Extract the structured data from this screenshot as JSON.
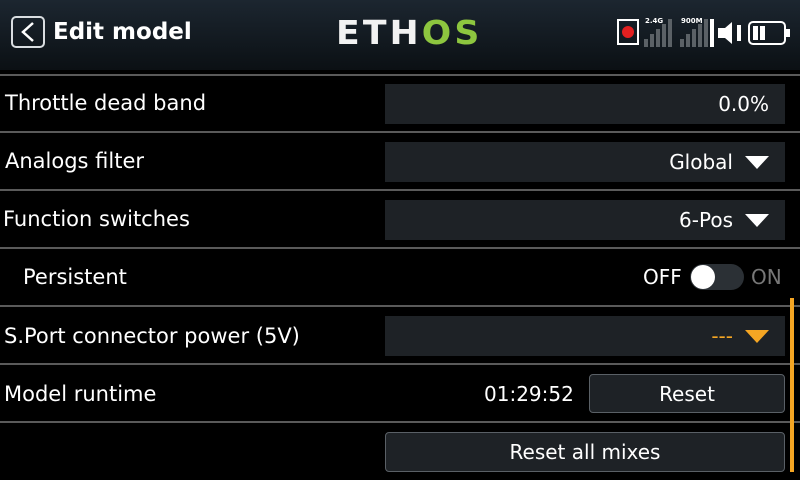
{
  "header": {
    "title": "Edit model",
    "logo_left": "ETH",
    "logo_right": "OS",
    "signal_24_label": "2.4G",
    "signal_900_label": "900M"
  },
  "rows": {
    "throttle_dead_band": {
      "label": "Throttle dead band",
      "value": "0.0%"
    },
    "analogs_filter": {
      "label": "Analogs filter",
      "value": "Global"
    },
    "function_switches": {
      "label": "Function switches",
      "value": "6-Pos"
    },
    "persistent": {
      "label": "Persistent",
      "off_label": "OFF",
      "on_label": "ON",
      "state": "off"
    },
    "sport_power": {
      "label": "S.Port connector power (5V)",
      "value": "---"
    },
    "model_runtime": {
      "label": "Model runtime",
      "value": "01:29:52",
      "reset_label": "Reset"
    },
    "reset_all": {
      "label": "Reset all mixes"
    }
  },
  "colors": {
    "accent": "#f5a623",
    "logo_green": "#8dc63f",
    "field_bg": "#1e2226",
    "record_red": "#e32020"
  }
}
